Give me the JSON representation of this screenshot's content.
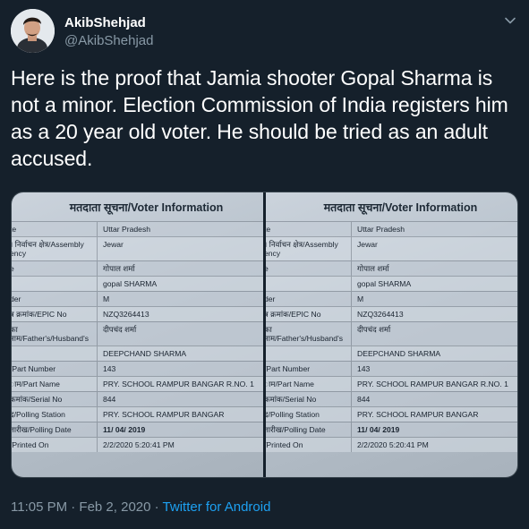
{
  "tweet": {
    "display_name": "AkibShehjad",
    "handle": "@AkibShehjad",
    "text": "Here is the proof that Jamia shooter Gopal Sharma is not a minor. Election Commission of India registers him as a 20 year old voter. He should be tried as an adult accused.",
    "timestamp": "11:05 PM · Feb 2, 2020 · ",
    "source": "Twitter for Android"
  },
  "colors": {
    "background": "#15202b",
    "secondary_text": "#8899a6",
    "link": "#1da1f2"
  },
  "icons": {
    "more": "chevron-down-icon",
    "avatar": "avatar"
  },
  "voter_card": {
    "title": "मतदाता सूचना/Voter Information",
    "rows": [
      {
        "label": "te",
        "value": "Uttar Pradesh"
      },
      {
        "label": "। निर्वाचन क्षेत्र/Assembly ency",
        "value": "Jewar"
      },
      {
        "label": "e",
        "value": "गोपाल शर्मा"
      },
      {
        "label": "",
        "value": "gopal SHARMA"
      },
      {
        "label": "der",
        "value": "M"
      },
      {
        "label": "त्र क्रमांक/EPIC No",
        "value": "NZQ3264413"
      },
      {
        "label": "का नाम/Father's/Husband's",
        "value": "दीपचंद शर्मा"
      },
      {
        "label": "",
        "value": "DEEPCHAND SHARMA"
      },
      {
        "label": "/Part Number",
        "value": "143"
      },
      {
        "label": "ाम/Part Name",
        "value": "PRY. SCHOOL RAMPUR BANGAR R.NO. 1"
      },
      {
        "label": "कमांक/Serial No",
        "value": "844"
      },
      {
        "label": "द्र/Polling Station",
        "value": "PRY. SCHOOL RAMPUR BANGAR"
      },
      {
        "label": "तारीख/Polling Date",
        "value": "11/ 04/ 2019"
      },
      {
        "label": "/Printed On",
        "value": "2/2/2020 5:20:41 PM"
      }
    ]
  }
}
